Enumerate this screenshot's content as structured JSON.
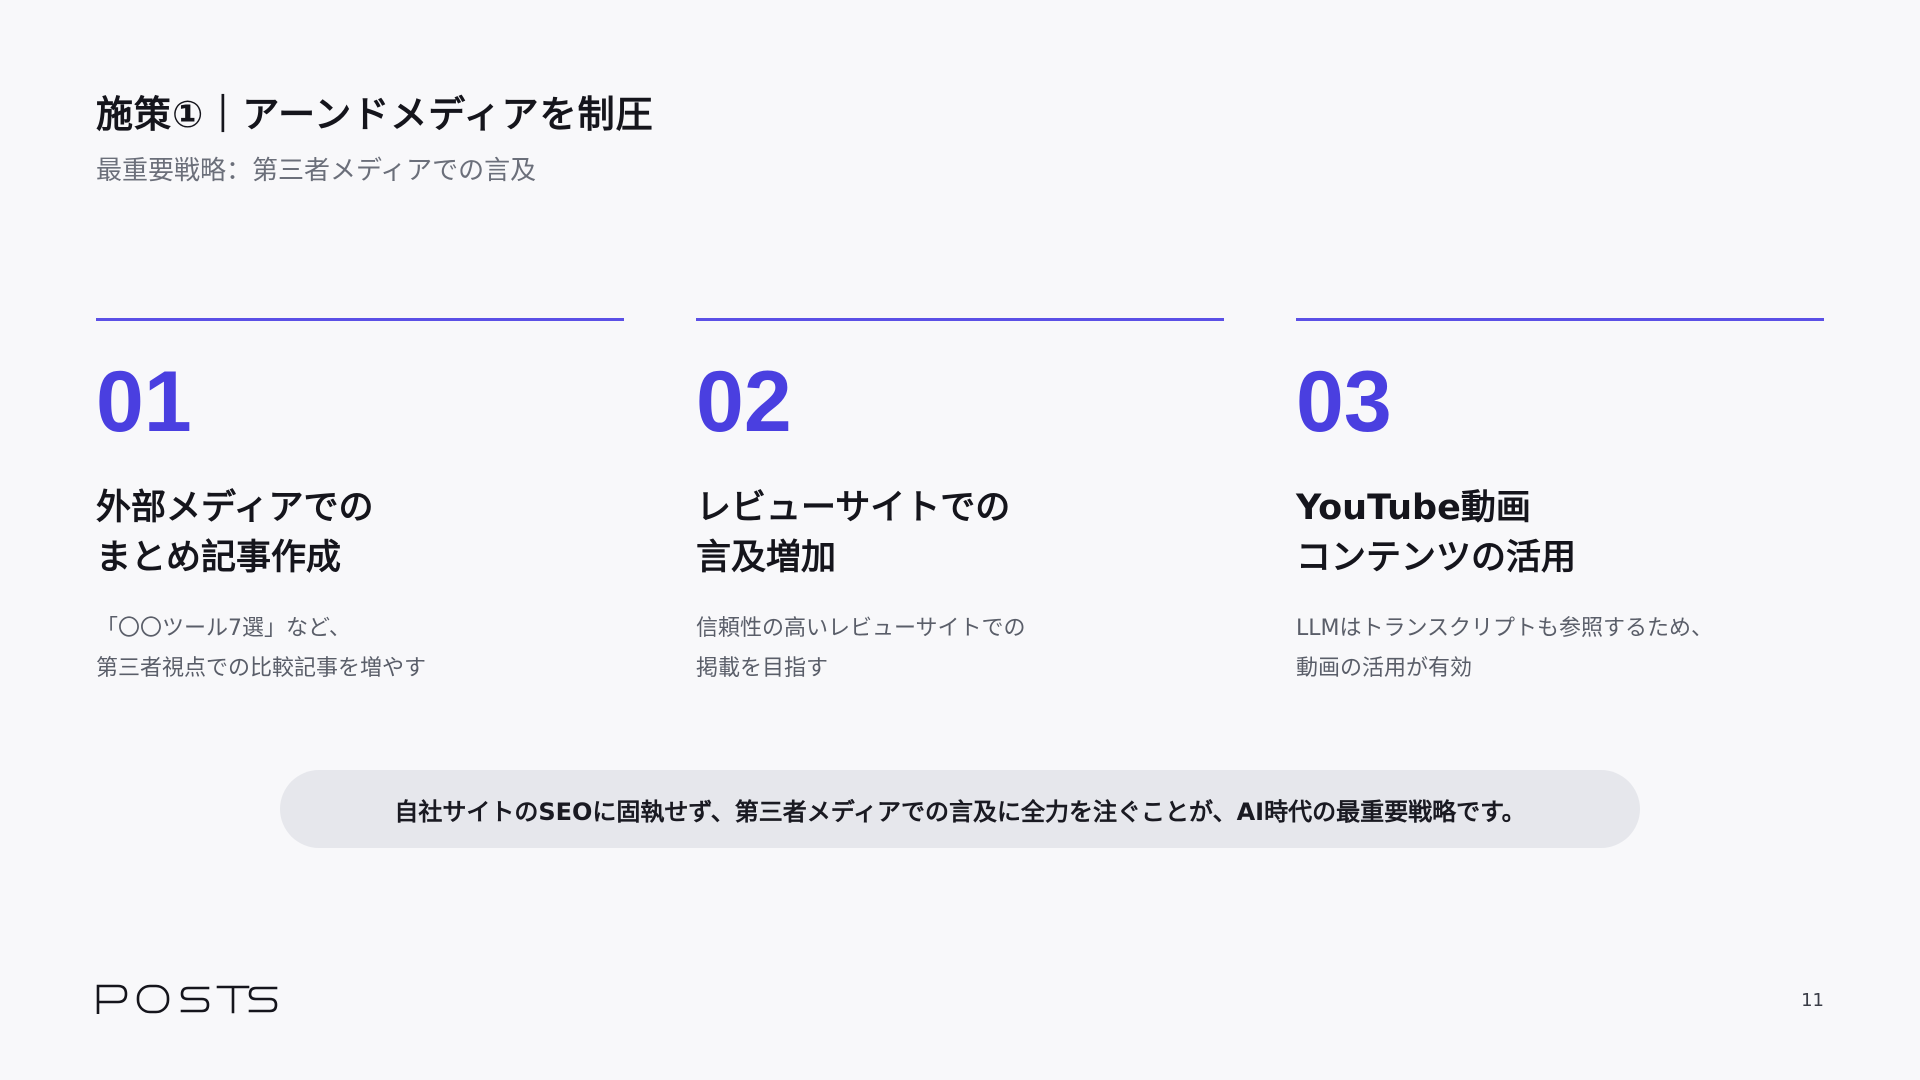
{
  "header": {
    "title": "施策①｜アーンドメディアを制圧",
    "subtitle": "最重要戦略：第三者メディアでの言及"
  },
  "columns": [
    {
      "number": "01",
      "heading": "外部メディアでの\nまとめ記事作成",
      "body": "「〇〇ツール7選」など、\n第三者視点での比較記事を増やす"
    },
    {
      "number": "02",
      "heading": "レビューサイトでの\n言及増加",
      "body": "信頼性の高いレビューサイトでの\n掲載を目指す"
    },
    {
      "number": "03",
      "heading": "YouTube動画\nコンテンツの活用",
      "body": "LLMはトランスクリプトも参照するため、\n動画の活用が有効"
    }
  ],
  "banner": {
    "text": "自社サイトのSEOに固執せず、第三者メディアでの言及に全力を注ぐことが、AI時代の最重要戦略です。"
  },
  "footer": {
    "logo_text": "POSTS",
    "page_number": "11"
  },
  "colors": {
    "accent": "#4a3fe0",
    "rule": "#5b50e6",
    "background": "#f8f8fa",
    "banner_bg": "#e6e7ec"
  }
}
